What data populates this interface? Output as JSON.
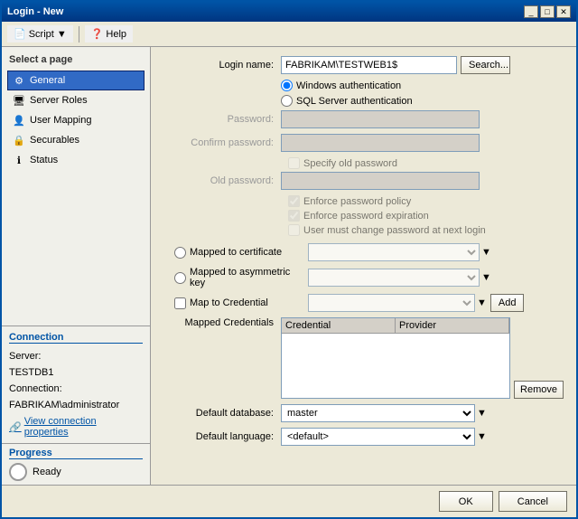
{
  "window": {
    "title": "Login - New",
    "controls": [
      "_",
      "□",
      "✕"
    ]
  },
  "toolbar": {
    "script_label": "Script",
    "help_label": "Help"
  },
  "sidebar": {
    "header": "Select a page",
    "items": [
      {
        "id": "general",
        "label": "General",
        "active": true
      },
      {
        "id": "server-roles",
        "label": "Server Roles",
        "active": false
      },
      {
        "id": "user-mapping",
        "label": "User Mapping",
        "active": false
      },
      {
        "id": "securables",
        "label": "Securables",
        "active": false
      },
      {
        "id": "status",
        "label": "Status",
        "active": false
      }
    ]
  },
  "form": {
    "login_name_label": "Login name:",
    "login_name_value": "FABRIKAM\\TESTWEB1$",
    "search_btn": "Search...",
    "windows_auth_label": "Windows authentication",
    "sql_auth_label": "SQL Server authentication",
    "password_label": "Password:",
    "confirm_password_label": "Confirm password:",
    "specify_old_pwd_label": "Specify old password",
    "old_password_label": "Old password:",
    "enforce_policy_label": "Enforce password policy",
    "enforce_expiration_label": "Enforce password expiration",
    "user_must_change_label": "User must change password at next login",
    "mapped_cert_label": "Mapped to certificate",
    "mapped_key_label": "Mapped to asymmetric key",
    "map_credential_label": "Map to Credential",
    "add_btn": "Add",
    "mapped_credentials_label": "Mapped Credentials",
    "credential_col": "Credential",
    "provider_col": "Provider",
    "remove_btn": "Remove",
    "default_database_label": "Default database:",
    "default_database_value": "master",
    "default_language_label": "Default language:",
    "default_language_value": "<default>"
  },
  "connection": {
    "header": "Connection",
    "server_label": "Server:",
    "server_value": "TESTDB1",
    "connection_label": "Connection:",
    "connection_value": "FABRIKAM\\administrator",
    "link_text": "View connection properties"
  },
  "progress": {
    "header": "Progress",
    "status": "Ready"
  },
  "footer": {
    "ok_label": "OK",
    "cancel_label": "Cancel"
  }
}
